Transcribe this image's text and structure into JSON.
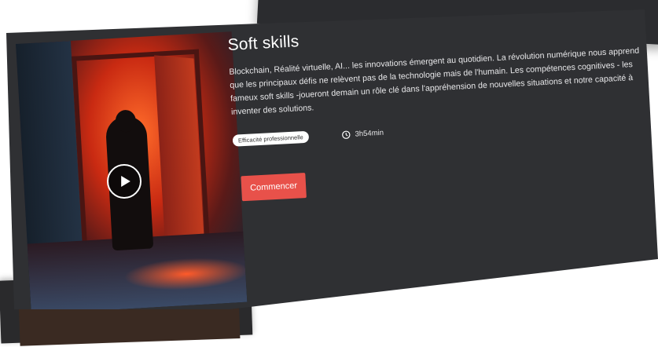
{
  "course": {
    "title": "Soft skills",
    "description": "Blockchain, Réalité virtuelle, AI... les innovations émergent au quotidien. La révolution numérique nous apprend que les principaux défis ne relèvent pas de la technologie mais de l'humain. Les compétences cognitives - les fameux soft skills -joueront demain un rôle clé dans l'appréhension de nouvelles situations et notre capacité à inventer des solutions.",
    "tag": "Efficacité professionnelle",
    "duration": "3h54min",
    "start_label": "Commencer"
  },
  "colors": {
    "card_bg": "#2f3033",
    "accent": "#e8514a",
    "tag_bg": "#ffffff"
  },
  "icons": {
    "play": "play-icon",
    "clock": "clock-icon"
  }
}
